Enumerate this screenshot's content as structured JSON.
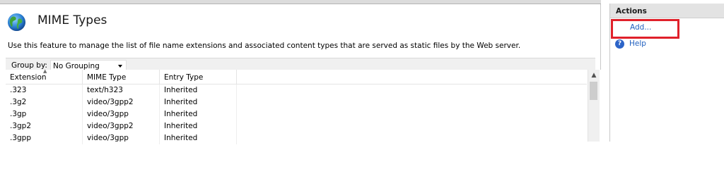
{
  "page": {
    "title": "MIME Types",
    "description": "Use this feature to manage the list of file name extensions and associated content types that are served as static files by the Web server."
  },
  "group_by": {
    "label": "Group by:",
    "value": "No Grouping"
  },
  "table": {
    "columns": [
      "Extension",
      "MIME Type",
      "Entry Type"
    ],
    "rows": [
      {
        "extension": ".323",
        "mime_type": "text/h323",
        "entry_type": "Inherited"
      },
      {
        "extension": ".3g2",
        "mime_type": "video/3gpp2",
        "entry_type": "Inherited"
      },
      {
        "extension": ".3gp",
        "mime_type": "video/3gpp",
        "entry_type": "Inherited"
      },
      {
        "extension": ".3gp2",
        "mime_type": "video/3gpp2",
        "entry_type": "Inherited"
      },
      {
        "extension": ".3gpp",
        "mime_type": "video/3gpp",
        "entry_type": "Inherited"
      }
    ]
  },
  "actions": {
    "title": "Actions",
    "items": [
      {
        "label": "Add...",
        "icon": ""
      },
      {
        "label": "Help",
        "icon": "help-icon"
      }
    ]
  },
  "colors": {
    "link": "#1f5fbf",
    "highlight_box": "#e0202a",
    "actions_header_bg": "#e3e3e3"
  }
}
